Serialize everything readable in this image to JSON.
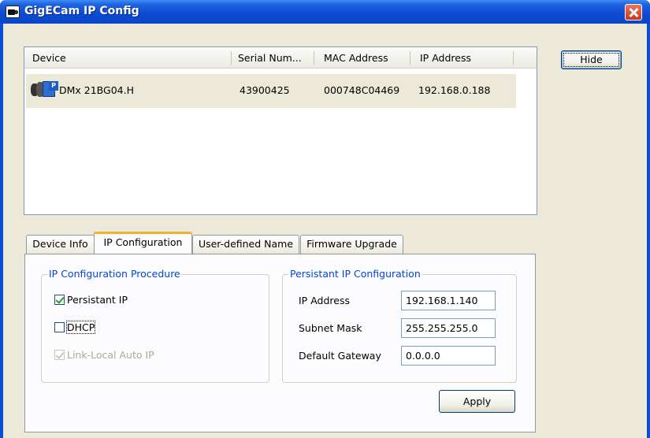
{
  "window": {
    "title": "GigECam IP Config",
    "title_color": "#0a49d0"
  },
  "device_list": {
    "columns": [
      "Device",
      "Serial Num...",
      "MAC Address",
      "IP Address"
    ],
    "rows": [
      {
        "icon": "camera-icon",
        "device": "DMx 21BG04.H",
        "serial": "43900425",
        "mac": "000748C04469",
        "ip": "192.168.0.188"
      }
    ]
  },
  "buttons": {
    "hide": "Hide",
    "apply": "Apply"
  },
  "tabs": [
    {
      "label": "Device Info",
      "active": false
    },
    {
      "label": "IP Configuration",
      "active": true
    },
    {
      "label": "User-defined Name",
      "active": false
    },
    {
      "label": "Firmware Upgrade",
      "active": false
    }
  ],
  "ip_procedure": {
    "title": "IP Configuration Procedure",
    "options": [
      {
        "label": "Persistant IP",
        "checked": true,
        "enabled": true
      },
      {
        "label": "DHCP",
        "checked": false,
        "enabled": true
      },
      {
        "label": "Link-Local Auto IP",
        "checked": true,
        "enabled": false
      }
    ]
  },
  "persistent_ip": {
    "title": "Persistant IP Configuration",
    "fields": [
      {
        "label": "IP Address",
        "value": "192.168.1.140"
      },
      {
        "label": "Subnet Mask",
        "value": "255.255.255.0"
      },
      {
        "label": "Default Gateway",
        "value": "0.0.0.0"
      }
    ]
  }
}
